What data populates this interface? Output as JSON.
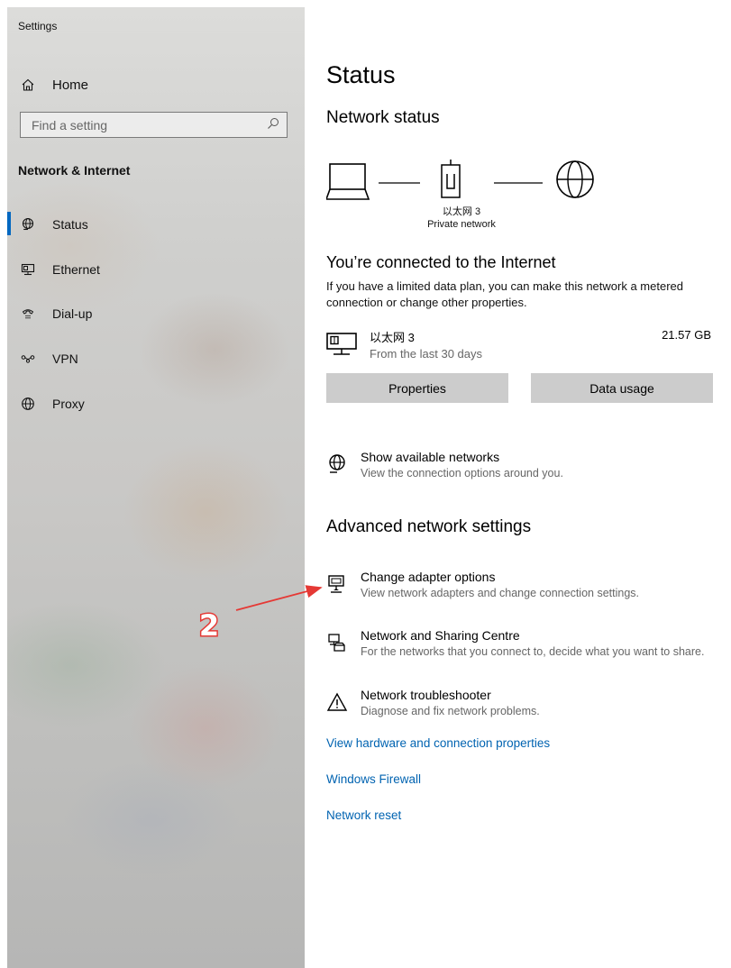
{
  "window": {
    "title": "Settings"
  },
  "sidebar": {
    "home_label": "Home",
    "search_placeholder": "Find a setting",
    "section_title": "Network & Internet",
    "items": [
      {
        "label": "Status",
        "icon": "status-globe-icon",
        "selected": true
      },
      {
        "label": "Ethernet",
        "icon": "ethernet-icon",
        "selected": false
      },
      {
        "label": "Dial-up",
        "icon": "dialup-icon",
        "selected": false
      },
      {
        "label": "VPN",
        "icon": "vpn-icon",
        "selected": false
      },
      {
        "label": "Proxy",
        "icon": "proxy-globe-icon",
        "selected": false
      }
    ]
  },
  "main": {
    "page_title": "Status",
    "network_status_heading": "Network status",
    "diagram": {
      "adapter_name": "以太网 3",
      "network_type": "Private network"
    },
    "connected_heading": "You’re connected to the Internet",
    "connected_text": "If you have a limited data plan, you can make this network a metered connection or change other properties.",
    "connection": {
      "name": "以太网 3",
      "subtitle": "From the last 30 days",
      "usage": "21.57 GB"
    },
    "buttons": {
      "properties": "Properties",
      "data_usage": "Data usage"
    },
    "show_networks": {
      "title": "Show available networks",
      "subtitle": "View the connection options around you."
    },
    "advanced_heading": "Advanced network settings",
    "advanced_options": [
      {
        "title": "Change adapter options",
        "subtitle": "View network adapters and change connection settings."
      },
      {
        "title": "Network and Sharing Centre",
        "subtitle": "For the networks that you connect to, decide what you want to share."
      },
      {
        "title": "Network troubleshooter",
        "subtitle": "Diagnose and fix network problems."
      }
    ],
    "links": [
      "View hardware and connection properties",
      "Windows Firewall",
      "Network reset"
    ]
  },
  "annotation": {
    "label": "2",
    "color": "#e53935"
  },
  "colors": {
    "accent": "#0067c0",
    "link": "#0063b1",
    "button": "#cccccc"
  }
}
